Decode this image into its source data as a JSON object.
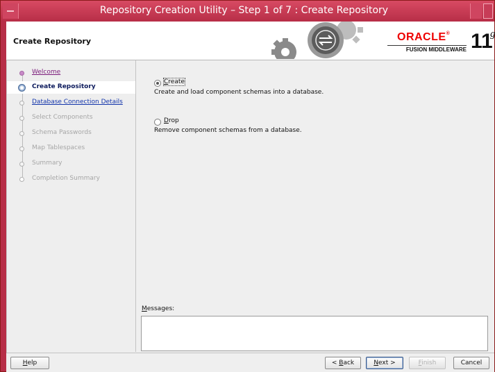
{
  "window": {
    "title": "Repository Creation Utility – Step 1 of 7 : Create Repository"
  },
  "header": {
    "page_title": "Create Repository",
    "logo_oracle": "ORACLE",
    "logo_reg": "®",
    "logo_fusion": "FUSION MIDDLEWARE",
    "logo_version": "11",
    "logo_suffix": "g"
  },
  "nav": {
    "items": [
      {
        "label": "Welcome",
        "state": "done"
      },
      {
        "label": "Create Repository",
        "state": "active"
      },
      {
        "label": "Database Connection Details",
        "state": "link"
      },
      {
        "label": "Select Components",
        "state": "disabled"
      },
      {
        "label": "Schema Passwords",
        "state": "disabled"
      },
      {
        "label": "Map Tablespaces",
        "state": "disabled"
      },
      {
        "label": "Summary",
        "state": "disabled"
      },
      {
        "label": "Completion Summary",
        "state": "disabled"
      }
    ]
  },
  "options": {
    "create": {
      "label_u": "C",
      "label_rest": "reate",
      "description": "Create and load component schemas into a database.",
      "selected": true
    },
    "drop": {
      "label_u": "D",
      "label_rest": "rop",
      "description": "Remove component schemas from a database.",
      "selected": false
    }
  },
  "messages": {
    "label_u": "M",
    "label_rest": "essages:",
    "value": ""
  },
  "buttons": {
    "help": {
      "u": "H",
      "rest": "elp"
    },
    "back": {
      "pre": "< ",
      "u": "B",
      "rest": "ack"
    },
    "next": {
      "u": "N",
      "rest": "ext >"
    },
    "finish": {
      "u": "F",
      "rest": "inish"
    },
    "cancel": {
      "pre": "Cancel"
    }
  },
  "colors": {
    "title_bar": "#b72e47",
    "oracle_red": "#e00000",
    "active_nav": "#0c1a5c",
    "link": "#1133aa"
  }
}
